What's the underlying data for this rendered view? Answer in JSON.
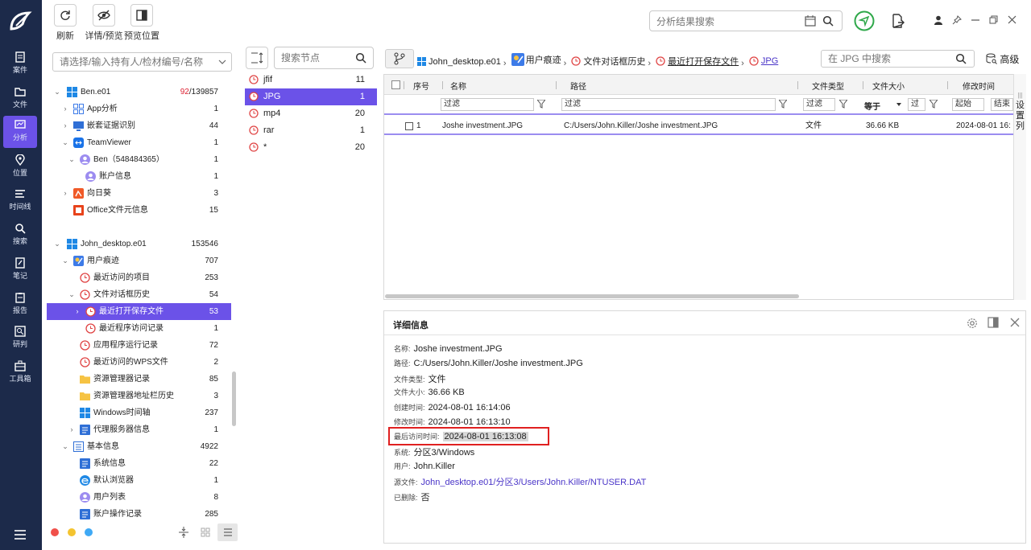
{
  "nav": {
    "items": [
      {
        "label": "案件",
        "icon": "case-icon"
      },
      {
        "label": "文件",
        "icon": "folder-icon"
      },
      {
        "label": "分析",
        "icon": "analysis-icon",
        "active": true
      },
      {
        "label": "位置",
        "icon": "location-icon"
      },
      {
        "label": "时间线",
        "icon": "timeline-icon"
      },
      {
        "label": "搜索",
        "icon": "search-icon"
      },
      {
        "label": "笔记",
        "icon": "note-icon"
      },
      {
        "label": "报告",
        "icon": "report-icon"
      },
      {
        "label": "研判",
        "icon": "research-icon"
      },
      {
        "label": "工具箱",
        "icon": "toolbox-icon"
      }
    ]
  },
  "toolbar": {
    "refresh": "刷新",
    "details_preview": "详情/预览",
    "preview_position": "预览位置",
    "search_placeholder": "分析结果搜索"
  },
  "tree": {
    "filter_placeholder": "请选择/输入持有人/检材编号/名称",
    "rows": [
      {
        "label": "Ben.e01",
        "count_red": "92",
        "count": "/139857"
      },
      {
        "label": "App分析",
        "count": "1"
      },
      {
        "label": "嵌套证据识别",
        "count": "44"
      },
      {
        "label": "TeamViewer",
        "count": "1"
      },
      {
        "label": "Ben（548484365）",
        "count": "1"
      },
      {
        "label": "账户信息",
        "count": "1"
      },
      {
        "label": "向日葵",
        "count": "3"
      },
      {
        "label": "Office文件元信息",
        "count": "15"
      },
      {
        "label": "John_desktop.e01",
        "count": "153546"
      },
      {
        "label": "用户痕迹",
        "count": "707"
      },
      {
        "label": "最近访问的项目",
        "count": "253"
      },
      {
        "label": "文件对话框历史",
        "count": "54"
      },
      {
        "label": "最近打开保存文件",
        "count": "53"
      },
      {
        "label": "最近程序访问记录",
        "count": "1"
      },
      {
        "label": "应用程序运行记录",
        "count": "72"
      },
      {
        "label": "最近访问的WPS文件",
        "count": "2"
      },
      {
        "label": "资源管理器记录",
        "count": "85"
      },
      {
        "label": "资源管理器地址栏历史",
        "count": "3"
      },
      {
        "label": "Windows时间轴",
        "count": "237"
      },
      {
        "label": "代理服务器信息",
        "count": "1"
      },
      {
        "label": "基本信息",
        "count": "4922"
      },
      {
        "label": "系统信息",
        "count": "22"
      },
      {
        "label": "默认浏览器",
        "count": "1"
      },
      {
        "label": "用户列表",
        "count": "8"
      },
      {
        "label": "账户操作记录",
        "count": "285"
      }
    ]
  },
  "ext": {
    "search_placeholder": "搜索节点",
    "rows": [
      {
        "label": "jfif",
        "count": "11"
      },
      {
        "label": "JPG",
        "count": "1"
      },
      {
        "label": "mp4",
        "count": "20"
      },
      {
        "label": "rar",
        "count": "1"
      },
      {
        "label": "*",
        "count": "20"
      }
    ]
  },
  "breadcrumb": {
    "items": [
      "John_desktop.e01",
      "用户痕迹",
      "文件对话框历史",
      "最近打开保存文件",
      "JPG"
    ],
    "search_placeholder": "在 JPG 中搜索",
    "advanced": "高级"
  },
  "table": {
    "headers": [
      "序号",
      "名称",
      "路径",
      "文件类型",
      "文件大小",
      "修改时间"
    ],
    "filter_label": "过滤",
    "equals_label": "等于",
    "start_label": "起始",
    "end_label": "结束",
    "settings_col": "设置列",
    "rows": [
      {
        "index": "1",
        "name": "Joshe investment.JPG",
        "path": "C:/Users/John.Killer/Joshe investment.JPG",
        "type": "文件",
        "size": "36.66 KB",
        "mtime": "2024-08-01 16:"
      }
    ]
  },
  "details": {
    "title": "详细信息",
    "fields": [
      {
        "label": "名称:",
        "value": "Joshe investment.JPG"
      },
      {
        "label": "路径:",
        "value": "C:/Users/John.Killer/Joshe investment.JPG"
      },
      {
        "label": "文件类型:",
        "value": "文件"
      },
      {
        "label": "文件大小:",
        "value": "36.66 KB"
      },
      {
        "label": "创建时间:",
        "value": "2024-08-01 16:14:06"
      },
      {
        "label": "修改时间:",
        "value": "2024-08-01 16:13:10"
      },
      {
        "label": "最后访问时间:",
        "value": "2024-08-01 16:13:08"
      },
      {
        "label": "系统:",
        "value": "分区3/Windows"
      },
      {
        "label": "用户:",
        "value": "John.Killer"
      },
      {
        "label": "源文件:",
        "value": "John_desktop.e01/分区3/Users/John.Killer/NTUSER.DAT"
      },
      {
        "label": "已删除:",
        "value": "否"
      }
    ]
  },
  "colors": {
    "accent": "#6b52e8",
    "nav_bg": "#1c2a4a",
    "highlight_border": "#e02020"
  }
}
